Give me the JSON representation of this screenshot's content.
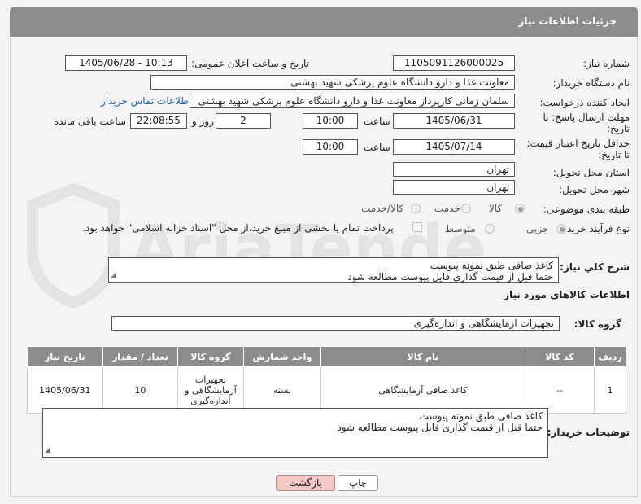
{
  "header": {
    "title": "جزئیات اطلاعات نیاز"
  },
  "fields": {
    "need_number_label": "شماره نیاز:",
    "need_number": "1105091126000025",
    "announce_label": "تاریخ و ساعت اعلان عمومی:",
    "announce_value": "1405/06/28 - 10:13",
    "buyer_org_label": "نام دستگاه خریدار:",
    "buyer_org": "معاونت غذا و دارو دانشگاه علوم پزشکی شهید بهشتی",
    "requester_label": "ایجاد کننده درخواست:",
    "requester": "سلمان زمانی کارپرداز معاونت غذا و دارو دانشگاه علوم پزشکی شهید بهشتی",
    "buyer_contact_link": "اطلاعات تماس خریدار",
    "deadline_label_1": "مهلت ارسال پاسخ: تا",
    "deadline_label_2": "تاریخ:",
    "deadline_date": "1405/06/31",
    "time_label": "ساعت",
    "deadline_time": "10:00",
    "days_value": "2",
    "days_label": "روز و",
    "remaining_time": "22:08:55",
    "remaining_label": "ساعت باقی مانده",
    "validity_label_1": "حداقل تاریخ اعتبار قیمت:",
    "validity_label_2": "تا تاریخ:",
    "validity_date": "1405/07/14",
    "validity_time_label": "ساعت",
    "validity_time": "10:00",
    "province_label": "استان محل تحویل:",
    "province": "تهران",
    "city_label": "شهر محل تحویل:",
    "city": "تهران",
    "category_label": "طبقه بندی موضوعی:",
    "category_options": [
      "کالا",
      "خدمت",
      "کالا/خدمت"
    ],
    "category_selected": "کالا",
    "process_label": "نوع فرآیند خرید :",
    "process_options": [
      "جزیی",
      "متوسط"
    ],
    "process_selected": "جزیی",
    "payment_note": "پرداخت تمام یا بخشی از مبلغ خرید،از محل \"اسناد خزانه اسلامی\" خواهد بود."
  },
  "summary": {
    "label": "شرح کلي نیاز:",
    "lines": [
      "کاغذ صافی طبق نمونه پیوست",
      "حتما قبل از قیمت گذاری فایل پیوست مطالعه شود"
    ]
  },
  "items_section": {
    "title": "اطلاعات کالاهای مورد نیاز",
    "group_label": "گروه کالا:",
    "group_value": "تجهیزات آزمایشگاهی و اندازه‌گیری"
  },
  "table": {
    "headers": [
      "ردیف",
      "کد کالا",
      "نام کالا",
      "واحد شمارش",
      "گروه کالا",
      "تعداد / مقدار",
      "تاریخ نیاز"
    ],
    "rows": [
      {
        "row": "1",
        "code": "--",
        "name": "کاغذ صافی آزمایشگاهی",
        "unit": "بسته",
        "group_lines": [
          "تجهیزات",
          "آزمایشگاهی و",
          "اندازه‌گیری"
        ],
        "qty": "10",
        "date": "1405/06/31"
      }
    ]
  },
  "buyer_notes": {
    "label": "توضیحات خریدار:",
    "lines": [
      "کاغذ صافی طبق نمونه پیوست",
      "حتما قبل از قیمت گذاری فایل پیوست مطالعه شود"
    ]
  },
  "buttons": {
    "back": "بازگشت",
    "print": "چاپ"
  },
  "watermark": {
    "text": "AriaTender.net"
  },
  "colors": {
    "header_bg": "#8c8c8c",
    "link": "#1a5fb4",
    "back_btn_bg": "#f5c6c6"
  }
}
